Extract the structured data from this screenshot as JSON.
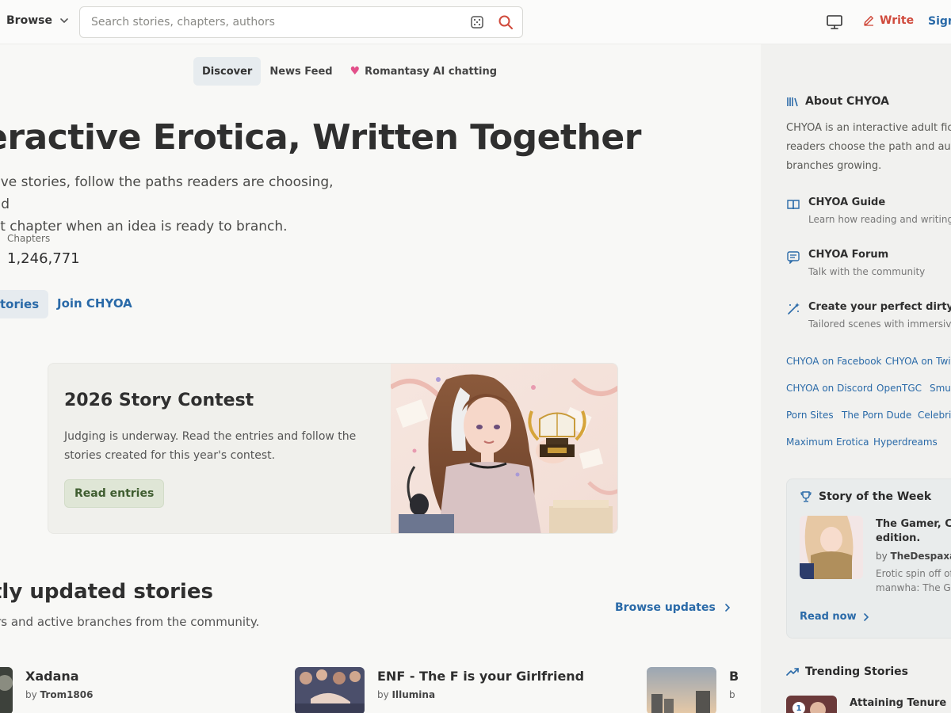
{
  "header": {
    "browse_label": "Browse",
    "search_placeholder": "Search stories, chapters, authors",
    "write_label": "Write",
    "sign_label": "Sign"
  },
  "tabs": [
    {
      "label": "Discover",
      "active": true
    },
    {
      "label": "News Feed",
      "active": false
    },
    {
      "label": "Romantasy AI chatting",
      "active": false
    }
  ],
  "hero": {
    "title": "eractive Erotica, Written Together",
    "subtitle_line1": "ctive stories, follow the paths readers are choosing, and",
    "subtitle_line2": "ext chapter when an idea is ready to branch.",
    "stat_label": "Chapters",
    "stat_value": "1,246,771",
    "cta_primary": "tories",
    "cta_secondary": "Join CHYOA"
  },
  "contest": {
    "title": "2026 Story Contest",
    "description": "Judging is underway. Read the entries and follow the stories created for this year's contest.",
    "button": "Read entries"
  },
  "recent": {
    "title": "tly updated stories",
    "subtitle": "ters and active branches from the community.",
    "browse_updates": "Browse updates",
    "cards": [
      {
        "title": "Xadana",
        "by": "by",
        "author": "Trom1806"
      },
      {
        "title": "ENF - The F is your Girlfriend",
        "by": "by",
        "author": "Illumina"
      },
      {
        "title": "B",
        "by": "b",
        "author": ""
      }
    ]
  },
  "sidebar": {
    "about_title": "About CHYOA",
    "about_text_line1": "CHYOA is an interactive adult ficti",
    "about_text_line2": "readers choose the path and auth",
    "about_text_line3": "branches growing.",
    "items": [
      {
        "title": "CHYOA Guide",
        "sub": "Learn how reading and writing w",
        "icon": "book-icon"
      },
      {
        "title": "CHYOA Forum",
        "sub": "Talk with the community",
        "icon": "forum-icon"
      },
      {
        "title": "Create your perfect dirty AI s",
        "sub": "Tailored scenes with immersive A",
        "icon": "magic-wand-icon"
      }
    ],
    "links": [
      [
        "CHYOA on Facebook",
        "CHYOA on Twitt"
      ],
      [
        "CHYOA on Discord",
        "OpenTGC",
        "Smut"
      ],
      [
        "Porn Sites",
        "The Porn Dude",
        "Celebrit"
      ],
      [
        "Maximum Erotica",
        "Hyperdreams"
      ]
    ],
    "sotw": {
      "heading": "Story of the Week",
      "title": "The Gamer, Chy edition.",
      "by": "by",
      "author": "TheDespaxas",
      "description": "Erotic spin off of manwha: The Ga",
      "read_now": "Read now"
    },
    "trending": {
      "heading": "Trending Stories",
      "rank": "1",
      "title": "Attaining Tenure"
    }
  },
  "colors": {
    "accent_blue": "#2a6aa8",
    "write_red": "#d04a3c",
    "heart_pink": "#e2508a",
    "contest_button_green": "#3f5d30"
  }
}
